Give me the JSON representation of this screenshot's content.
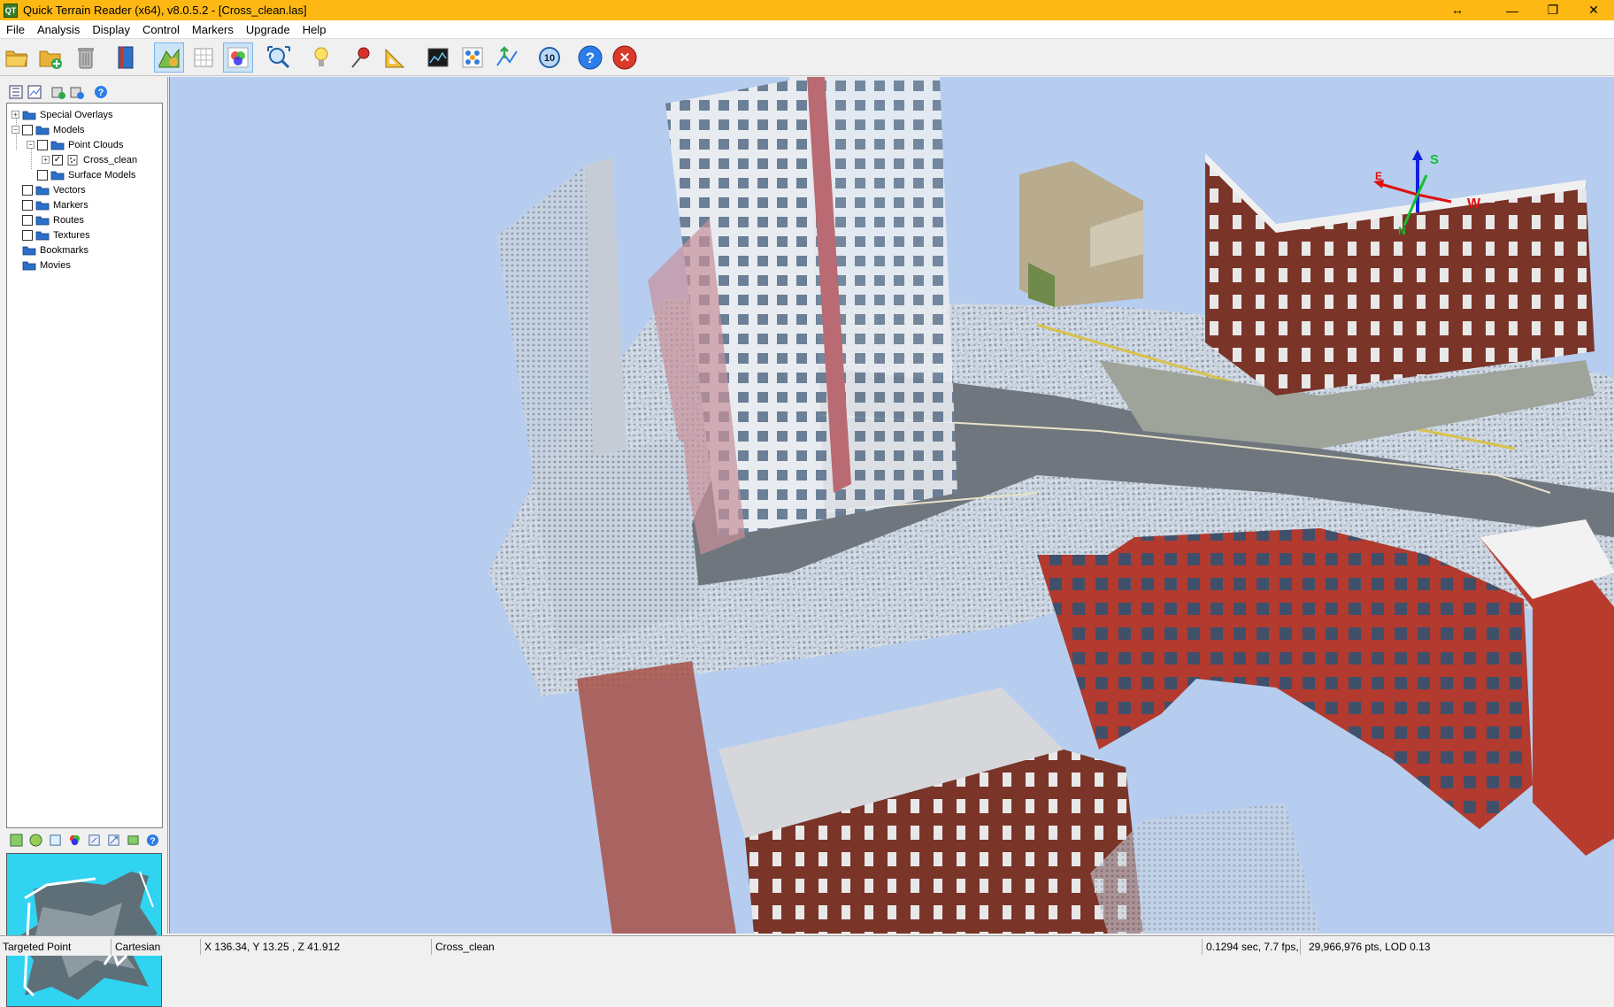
{
  "window": {
    "title": "Quick Terrain Reader (x64), v8.0.5.2  - [Cross_clean.las]",
    "app_icon": "QT",
    "resize_glyph": "↔",
    "buttons": [
      "—",
      "❐",
      "✕"
    ]
  },
  "menu": [
    "File",
    "Analysis",
    "Display",
    "Control",
    "Markers",
    "Upgrade",
    "Help"
  ],
  "toolbar": [
    {
      "name": "open-folder-icon"
    },
    {
      "name": "add-model-icon"
    },
    {
      "name": "trash-can-icon"
    },
    {
      "name": "book-icon"
    },
    {
      "name": "color-by-height-icon",
      "active": true
    },
    {
      "name": "grid-icon"
    },
    {
      "name": "rgb-color-icon",
      "active": true
    },
    {
      "name": "zoom-fit-icon"
    },
    {
      "name": "lightbulb-icon"
    },
    {
      "name": "marker-pin-icon"
    },
    {
      "name": "ruler-icon"
    },
    {
      "name": "profile-chart-icon"
    },
    {
      "name": "point-cloud-icon"
    },
    {
      "name": "flythrough-icon"
    },
    {
      "name": "refresh-10-icon",
      "label": "10"
    },
    {
      "name": "help-icon",
      "label": "?"
    },
    {
      "name": "exit-icon",
      "label": "✕"
    }
  ],
  "tree": {
    "items": [
      {
        "label": "Special Overlays",
        "level": 0,
        "expander": "+",
        "checkbox": false,
        "folder": true
      },
      {
        "label": "Models",
        "level": 0,
        "expander": "−",
        "checkbox": true,
        "checked": false,
        "folder": true
      },
      {
        "label": "Point Clouds",
        "level": 1,
        "expander": "−",
        "checkbox": true,
        "checked": false,
        "folder": true
      },
      {
        "label": "Cross_clean",
        "level": 2,
        "expander": "+",
        "checkbox": true,
        "checked": true,
        "folder": false
      },
      {
        "label": "Surface Models",
        "level": 1,
        "expander": "",
        "checkbox": true,
        "checked": false,
        "folder": true
      },
      {
        "label": "Vectors",
        "level": 0,
        "expander": "",
        "checkbox": true,
        "checked": false,
        "folder": true
      },
      {
        "label": "Markers",
        "level": 0,
        "expander": "",
        "checkbox": true,
        "checked": false,
        "folder": true
      },
      {
        "label": "Routes",
        "level": 0,
        "expander": "",
        "checkbox": true,
        "checked": false,
        "folder": true
      },
      {
        "label": "Textures",
        "level": 0,
        "expander": "",
        "checkbox": true,
        "checked": false,
        "folder": true
      },
      {
        "label": "Bookmarks",
        "level": 0,
        "expander": "",
        "checkbox": false,
        "folder": true
      },
      {
        "label": "Movies",
        "level": 0,
        "expander": "",
        "checkbox": false,
        "folder": true
      }
    ]
  },
  "axes": {
    "s": "S",
    "w": "W",
    "e": "E",
    "n": "N"
  },
  "status": {
    "mode": "Targeted Point",
    "coord_system": "Cartesian",
    "coords": "X 136.34, Y 13.25 , Z 41.912",
    "model": "Cross_clean",
    "timing": "0.1294 sec,   7.7 fps,",
    "points": "29,966,976 pts, LOD 0.13"
  }
}
